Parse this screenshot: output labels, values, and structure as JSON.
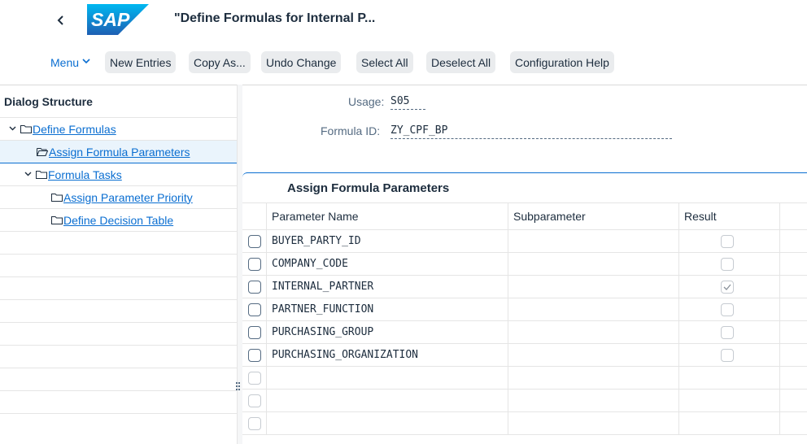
{
  "shell": {
    "title": "\"Define Formulas for Internal P...",
    "logo_text": "SAP",
    "back_icon": "chevron-left-icon"
  },
  "toolbar": {
    "menu_label": "Menu",
    "new_entries": "New Entries",
    "copy_as": "Copy As...",
    "undo_change": "Undo Change",
    "select_all": "Select All",
    "deselect_all": "Deselect All",
    "configuration_help": "Configuration Help"
  },
  "dialog_structure": {
    "header": "Dialog Structure",
    "items": [
      {
        "label": "Define Formulas",
        "level": 1,
        "expanded": true,
        "selected": false
      },
      {
        "label": "Assign Formula Parameters",
        "level": 2,
        "expanded": false,
        "selected": true
      },
      {
        "label": "Formula Tasks",
        "level": 2,
        "expanded": true,
        "selected": false
      },
      {
        "label": "Assign Parameter Priority",
        "level": 3,
        "expanded": false,
        "selected": false
      },
      {
        "label": "Define Decision Table",
        "level": 3,
        "expanded": false,
        "selected": false
      }
    ]
  },
  "header_fields": {
    "usage_label": "Usage:",
    "usage_value": "S05",
    "formula_id_label": "Formula ID:",
    "formula_id_value": "ZY_CPF_BP"
  },
  "table": {
    "title": "Assign Formula Parameters",
    "columns": [
      "Parameter Name",
      "Subparameter",
      "Result"
    ],
    "rows": [
      {
        "parameter": "BUYER_PARTY_ID",
        "subparameter": "",
        "result": false
      },
      {
        "parameter": "COMPANY_CODE",
        "subparameter": "",
        "result": false
      },
      {
        "parameter": "INTERNAL_PARTNER",
        "subparameter": "",
        "result": true
      },
      {
        "parameter": "PARTNER_FUNCTION",
        "subparameter": "",
        "result": false
      },
      {
        "parameter": "PURCHASING_GROUP",
        "subparameter": "",
        "result": false
      },
      {
        "parameter": "PURCHASING_ORGANIZATION",
        "subparameter": "",
        "result": false
      }
    ],
    "empty_rows": 3
  },
  "colors": {
    "brand_blue": "#0a6ed1",
    "text": "#1d2d3e",
    "button_bg": "#eaecee",
    "selected_bg": "#eaf4fc"
  }
}
